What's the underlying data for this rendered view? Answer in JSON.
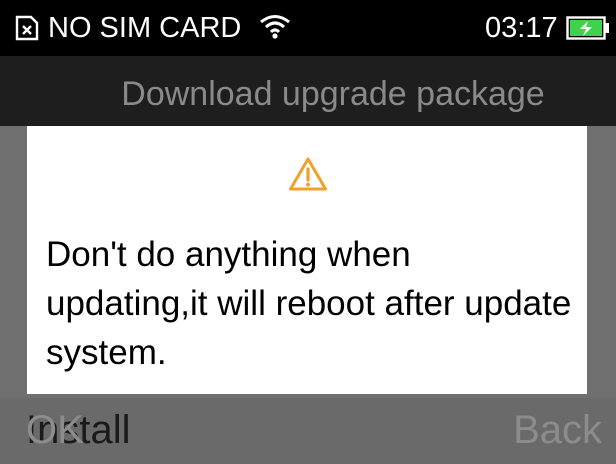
{
  "status_bar": {
    "sim_icon": "no-sim-icon",
    "sim_label": "NO SIM CARD",
    "wifi_icon": "wifi-icon",
    "time": "03:17",
    "battery_icon": "battery-charging-icon"
  },
  "title_bar": {
    "title": "Download upgrade package"
  },
  "dialog": {
    "icon": "warning-icon",
    "message": "Don't do anything when updating,it will reboot after update system."
  },
  "softkeys": {
    "left_background_label": "Install",
    "left_label": "OK",
    "right_label": "Back"
  },
  "colors": {
    "status_bar": "#000000",
    "title_bar": "#1e1e1e",
    "dim_overlay": "#6f6f6f",
    "dialog_background": "#ffffff",
    "warning": "#f0a12a",
    "battery": "#3fd24a",
    "muted_text": "#8c8c8c"
  }
}
